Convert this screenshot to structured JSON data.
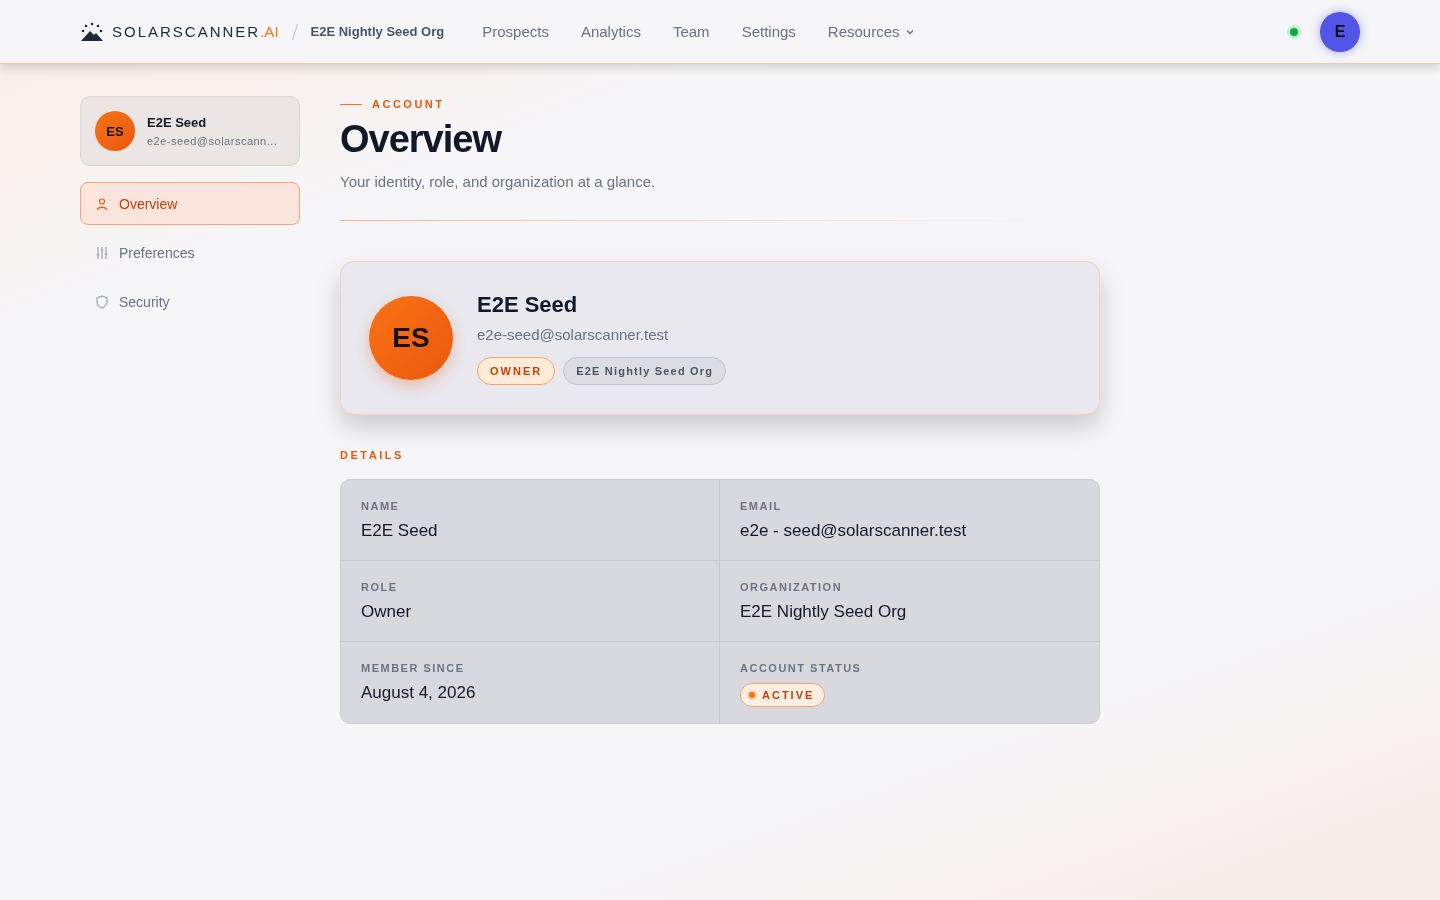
{
  "brand": {
    "name": "SOLARSCANNER",
    "suffix": ".AI"
  },
  "org": "E2E Nightly Seed Org",
  "nav": [
    {
      "label": "Prospects",
      "dropdown": false
    },
    {
      "label": "Analytics",
      "dropdown": false
    },
    {
      "label": "Team",
      "dropdown": false
    },
    {
      "label": "Settings",
      "dropdown": false
    },
    {
      "label": "Resources",
      "dropdown": true
    }
  ],
  "user_avatar": "E",
  "sidebar": {
    "user": {
      "initials": "ES",
      "name": "E2E Seed",
      "email": "e2e-seed@solarscann..."
    },
    "items": [
      {
        "label": "Overview",
        "kind": "person",
        "selected": true
      },
      {
        "label": "Preferences",
        "kind": "sliders",
        "selected": false
      },
      {
        "label": "Security",
        "kind": "shield",
        "selected": false
      }
    ]
  },
  "eyebrow": "ACCOUNT",
  "title": "Overview",
  "subtitle": "Your identity, role, and organization at a glance.",
  "profile": {
    "initials": "ES",
    "name": "E2E Seed",
    "email": "e2e-seed@solarscanner.test",
    "role_badge": "OWNER",
    "org_badge": "E2E Nightly Seed Org"
  },
  "details_heading": "DETAILS",
  "details": [
    {
      "label": "NAME",
      "value": "E2E Seed",
      "kind": "text"
    },
    {
      "label": "EMAIL",
      "value": "e2e - seed@solarscanner.test",
      "kind": "text"
    },
    {
      "label": "ROLE",
      "value": "Owner",
      "kind": "text"
    },
    {
      "label": "ORGANIZATION",
      "value": "E2E Nightly Seed Org",
      "kind": "text"
    },
    {
      "label": "MEMBER SINCE",
      "value": "August 4, 2026",
      "kind": "text"
    },
    {
      "label": "ACCOUNT STATUS",
      "value": "ACTIVE",
      "kind": "status"
    }
  ]
}
